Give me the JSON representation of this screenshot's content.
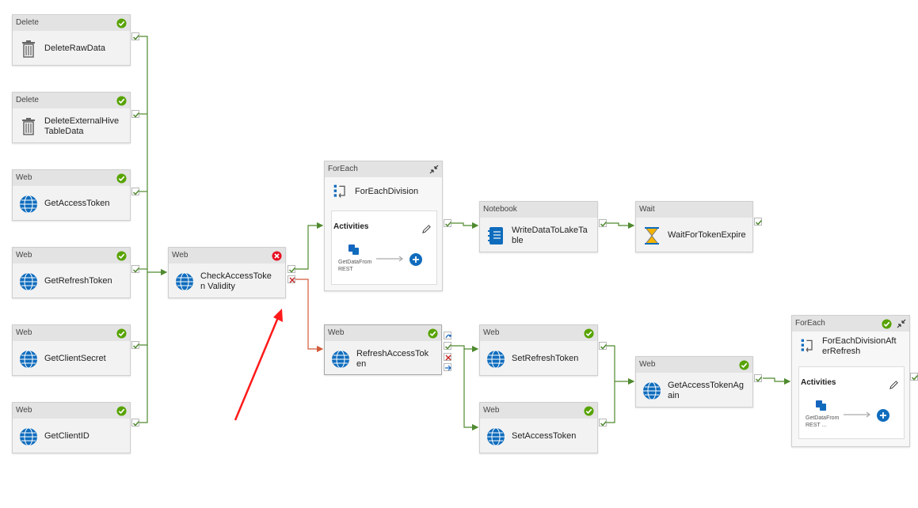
{
  "colors": {
    "success": "#4f8a2f",
    "fail": "#d15b3a",
    "header": "#e3e3e3",
    "web_icon": "#0f6cbd",
    "annotation_arrow": "#ff1a1a"
  },
  "activities": {
    "delete_raw": {
      "type": "Delete",
      "name": "DeleteRawData",
      "icon": "trash-icon",
      "status": "succeeded"
    },
    "delete_hive": {
      "type": "Delete",
      "name": "DeleteExternalHive TableData",
      "icon": "trash-icon",
      "status": "succeeded"
    },
    "get_access_token": {
      "type": "Web",
      "name": "GetAccessToken",
      "icon": "globe-icon",
      "status": "succeeded"
    },
    "get_refresh_token": {
      "type": "Web",
      "name": "GetRefreshToken",
      "icon": "globe-icon",
      "status": "succeeded"
    },
    "get_client_secret": {
      "type": "Web",
      "name": "GetClientSecret",
      "icon": "globe-icon",
      "status": "succeeded"
    },
    "get_client_id": {
      "type": "Web",
      "name": "GetClientID",
      "icon": "globe-icon",
      "status": "succeeded"
    },
    "check_validity": {
      "type": "Web",
      "name": "CheckAccessToken Validity",
      "icon": "globe-icon",
      "status": "failed"
    },
    "foreach_division": {
      "type": "ForEach",
      "name": "ForEachDivision",
      "icon": "foreach-icon",
      "activities_label": "Activities",
      "inner_activity": "GetDataFromREST"
    },
    "write_data": {
      "type": "Notebook",
      "name": "WriteDataToLakeTable",
      "icon": "notebook-icon"
    },
    "wait_token": {
      "type": "Wait",
      "name": "WaitForTokenExpire",
      "icon": "hourglass-icon"
    },
    "refresh_token": {
      "type": "Web",
      "name": "RefreshAccessToken",
      "icon": "globe-icon",
      "status": "succeeded"
    },
    "set_refresh_token": {
      "type": "Web",
      "name": "SetRefreshToken",
      "icon": "globe-icon",
      "status": "succeeded"
    },
    "set_access_token": {
      "type": "Web",
      "name": "SetAccessToken",
      "icon": "globe-icon",
      "status": "succeeded"
    },
    "get_access_token_again": {
      "type": "Web",
      "name": "GetAccessTokenAgain",
      "icon": "globe-icon",
      "status": "succeeded"
    },
    "foreach_after_refresh": {
      "type": "ForEach",
      "name": "ForEachDivisionAfterRefresh",
      "icon": "foreach-icon",
      "status": "succeeded",
      "activities_label": "Activities",
      "inner_activity": "GetDataFromREST ..."
    }
  }
}
